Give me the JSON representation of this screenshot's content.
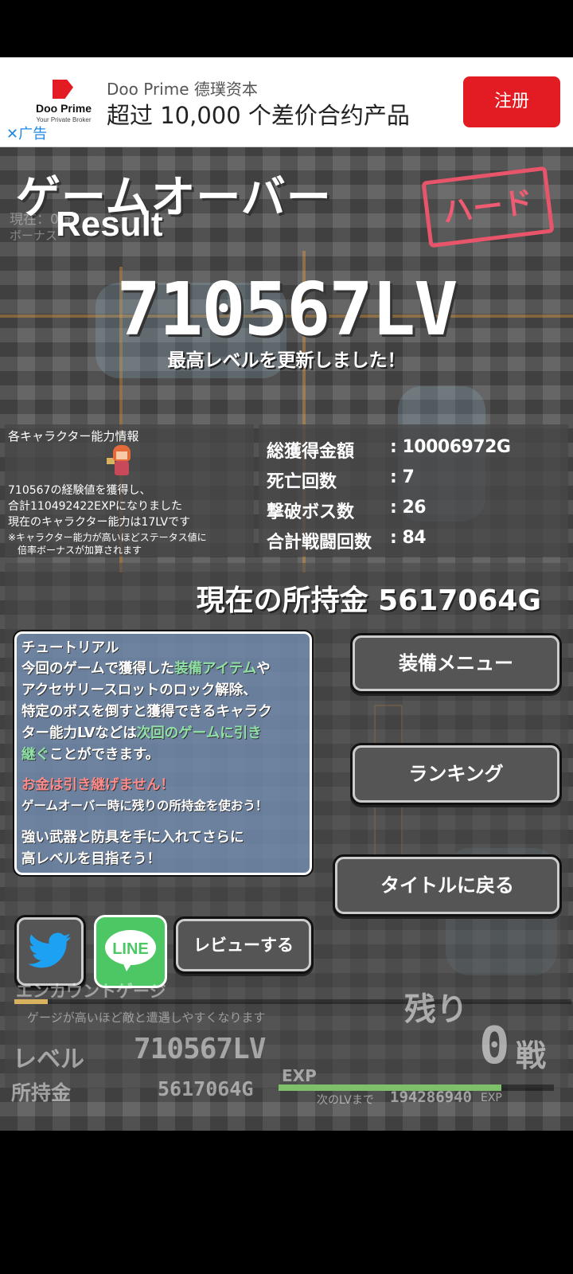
{
  "ad": {
    "logo_name": "Doo Prime",
    "logo_tagline": "Your Private Broker",
    "brand": "Doo Prime 德璞资本",
    "headline": "超过 10,000 个差价合约产品",
    "cta_label": "注册",
    "close_label": "✕",
    "ad_label": "广告"
  },
  "header": {
    "title": "ゲームオーバー",
    "result_label": "Result",
    "ghost_line1": "現在：0分",
    "ghost_line2": "ボーナス",
    "difficulty_stamp": "ハード"
  },
  "result": {
    "level": "710567LV",
    "record_message": "最高レベルを更新しました！"
  },
  "character_info": {
    "title": "各キャラクター能力情報",
    "line1": "710567の経験値を獲得し、",
    "line2": "合計110492422EXPになりました",
    "line3": "現在のキャラクター能力は17LVです",
    "note1": "※キャラクター能力が高いほどステータス値に",
    "note2": "　倍率ボーナスが加算されます"
  },
  "stats": [
    {
      "label": "総獲得金額",
      "value": ": 10006972G"
    },
    {
      "label": "死亡回数",
      "value": ": 7"
    },
    {
      "label": "撃破ボス数",
      "value": ": 26"
    },
    {
      "label": "合計戦闘回数",
      "value": ": 84"
    }
  ],
  "money": {
    "current": "現在の所持金 5617064G"
  },
  "tutorial": {
    "title": "チュートリアル",
    "p1_a": "今回のゲームで獲得した",
    "p1_hl1": "装備アイテム",
    "p1_b": "や",
    "p1_line2": "アクセサリースロットのロック解除、",
    "p1_line3": "特定のボスを倒すと獲得できるキャラク",
    "p1_line4_a": "ター能力LVなどは",
    "p1_hl2": "次回のゲームに引き",
    "p1_hl3": "継ぐ",
    "p1_line5_b": "ことができます。",
    "warn": "お金は引き継げません！",
    "warn_sub": "ゲームオーバー時に残りの所持金を使おう！",
    "p3_line1": "強い武器と防具を手に入れてさらに",
    "p3_line2": "高レベルを目指そう！"
  },
  "buttons": {
    "equipment": "装備メニュー",
    "ranking": "ランキング",
    "title": "タイトルに戻る",
    "line": "LINE",
    "review": "レビューする"
  },
  "hud": {
    "encounter_label": "エンカウントゲージ",
    "encounter_help": "ゲージが高いほど敵と遭遇しやすくなります",
    "encounter_fill_fraction": 0.06,
    "remain_label": "残り",
    "remain_count": "0",
    "remain_unit": "戦",
    "level_label": "レベル",
    "level_value": "710567LV",
    "money_label": "所持金",
    "money_value": "5617064G",
    "exp_label": "EXP",
    "exp_fill_fraction": 0.81,
    "next_label": "次のLVまで",
    "next_value": "194286940",
    "next_unit": "EXP"
  },
  "colors": {
    "ad_red": "#e31b23",
    "stamp_pink": "#ee5b72",
    "highlight_green": "#8fe1a6",
    "warning_red": "#ff8a8a",
    "line_green": "#4cc764",
    "twitter_blue": "#1da1f2"
  },
  "icons": {
    "twitter": "twitter-bird-icon",
    "line": "line-app-icon",
    "close": "close-icon"
  }
}
